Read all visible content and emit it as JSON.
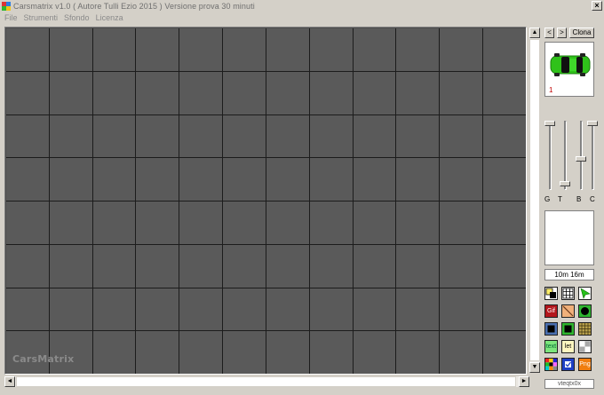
{
  "window": {
    "title": "Carsmatrix v1.0 ( Autore Tulli Ezio 2015 ) Versione prova 30 minuti",
    "close_label": "×"
  },
  "menu": [
    "File",
    "Strumenti",
    "Sfondo",
    "Licenza"
  ],
  "canvas": {
    "rows": 8,
    "columns": 12,
    "watermark": "CarsMatrix",
    "background_color": "#5a5a5a",
    "grid_line_color": "#1c1c1c"
  },
  "scrollbars": {
    "up_arrow": "▲",
    "down_arrow": "▼",
    "left_arrow": "◄",
    "right_arrow": "►"
  },
  "panel": {
    "prev_label": "<",
    "next_label": ">",
    "clone_label": "Clona",
    "car_number": "1",
    "car_color": "#2fc21a",
    "slider_labels": [
      "G",
      "T",
      "B",
      "C"
    ],
    "slider_levels": [
      1.0,
      0.05,
      0.45,
      1.0
    ],
    "size_label": "10m 16m",
    "status_text": "vteqtx0x"
  },
  "tools": [
    {
      "name": "color-fill-tool",
      "label": ""
    },
    {
      "name": "grid-tool",
      "label": ""
    },
    {
      "name": "select-arrow-tool",
      "label": ""
    },
    {
      "name": "gif-tool",
      "label": "Gif"
    },
    {
      "name": "diagonal-tool",
      "label": ""
    },
    {
      "name": "circle-tool",
      "label": ""
    },
    {
      "name": "black-square-tool",
      "label": ""
    },
    {
      "name": "green-square-tool",
      "label": ""
    },
    {
      "name": "pattern-tool",
      "label": ""
    },
    {
      "name": "text-tool",
      "label": "text"
    },
    {
      "name": "letter-tool",
      "label": "let"
    },
    {
      "name": "gray-grid-tool",
      "label": ""
    },
    {
      "name": "palette-tool",
      "label": ""
    },
    {
      "name": "check-tool",
      "label": ""
    },
    {
      "name": "png-tool",
      "label": "Png"
    }
  ]
}
